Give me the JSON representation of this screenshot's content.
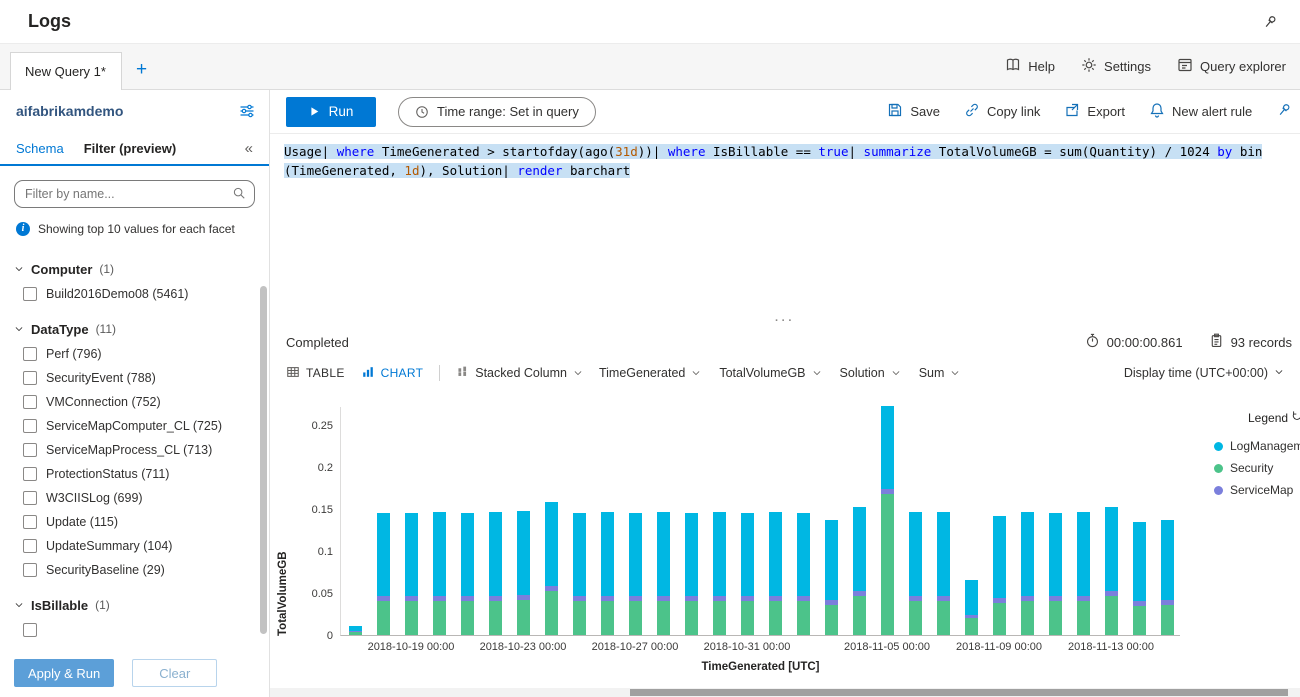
{
  "titlebar": {
    "title": "Logs"
  },
  "tabbar": {
    "active_tab": "New Query 1*",
    "new_tab": "+",
    "actions": [
      "Help",
      "Settings",
      "Query explorer"
    ]
  },
  "sidebar": {
    "workspace": "aifabrikamdemo",
    "tab_schema": "Schema",
    "tab_filter": "Filter (preview)",
    "collapse": "«",
    "search_placeholder": "Filter by name...",
    "info": "Showing top 10 values for each facet",
    "facets": [
      {
        "name": "Computer",
        "count": "(1)",
        "items": [
          {
            "label": "Build2016Demo08",
            "count": "(5461)"
          }
        ]
      },
      {
        "name": "DataType",
        "count": "(11)",
        "items": [
          {
            "label": "Perf",
            "count": "(796)"
          },
          {
            "label": "SecurityEvent",
            "count": "(788)"
          },
          {
            "label": "VMConnection",
            "count": "(752)"
          },
          {
            "label": "ServiceMapComputer_CL",
            "count": "(725)"
          },
          {
            "label": "ServiceMapProcess_CL",
            "count": "(713)"
          },
          {
            "label": "ProtectionStatus",
            "count": "(711)"
          },
          {
            "label": "W3CIISLog",
            "count": "(699)"
          },
          {
            "label": "Update",
            "count": "(115)"
          },
          {
            "label": "UpdateSummary",
            "count": "(104)"
          },
          {
            "label": "SecurityBaseline",
            "count": "(29)"
          }
        ]
      },
      {
        "name": "IsBillable",
        "count": "(1)",
        "items": [
          {
            "label": "",
            "count": ""
          }
        ]
      }
    ],
    "apply_button": "Apply & Run",
    "clear_button": "Clear"
  },
  "toolbar": {
    "run": "Run",
    "time_range": "Time range: Set in query",
    "actions": [
      "Save",
      "Copy link",
      "Export",
      "New alert rule",
      "Pin"
    ]
  },
  "query": {
    "lines": [
      [
        {
          "t": "Usage| ",
          "c": "p"
        },
        {
          "t": "where",
          "c": "k"
        },
        {
          "t": " TimeGenerated > startofday(ago(",
          "c": "p"
        },
        {
          "t": "31d",
          "c": "n"
        },
        {
          "t": "))| ",
          "c": "p"
        },
        {
          "t": "where",
          "c": "k"
        },
        {
          "t": " IsBillable == ",
          "c": "p"
        },
        {
          "t": "true",
          "c": "k"
        },
        {
          "t": "| ",
          "c": "p"
        },
        {
          "t": "summarize",
          "c": "k"
        },
        {
          "t": " TotalVolumeGB = sum(Quantity) / 1024 ",
          "c": "p"
        },
        {
          "t": "by",
          "c": "k"
        },
        {
          "t": " bin",
          "c": "p"
        }
      ],
      [
        {
          "t": "(TimeGenerated, ",
          "c": "p"
        },
        {
          "t": "1d",
          "c": "n"
        },
        {
          "t": "), Solution| ",
          "c": "p"
        },
        {
          "t": "render",
          "c": "k"
        },
        {
          "t": " barchart",
          "c": "p"
        }
      ]
    ]
  },
  "results": {
    "status": "Completed",
    "elapsed": "00:00:00.861",
    "records": "93 records",
    "table_tab": "TABLE",
    "chart_tab": "CHART",
    "chart_type": "Stacked Column",
    "dropdowns": [
      "TimeGenerated",
      "TotalVolumeGB",
      "Solution",
      "Sum"
    ],
    "display_time": "Display time (UTC+00:00)",
    "splitter": "···"
  },
  "legend": {
    "title": "Legend",
    "items": [
      {
        "label": "LogManagement",
        "color": "#00b7e3"
      },
      {
        "label": "Security",
        "color": "#4cc38a"
      },
      {
        "label": "ServiceMap",
        "color": "#7b7fdc"
      }
    ]
  },
  "chart_data": {
    "type": "bar",
    "stacked": true,
    "title": "",
    "xlabel": "TimeGenerated [UTC]",
    "ylabel": "TotalVolumeGB",
    "ylim": [
      0,
      0.2726
    ],
    "grid": false,
    "legend_position": "top-right",
    "x": [
      "2018-10-17",
      "2018-10-18",
      "2018-10-19",
      "2018-10-20",
      "2018-10-21",
      "2018-10-22",
      "2018-10-23",
      "2018-10-24",
      "2018-10-25",
      "2018-10-26",
      "2018-10-27",
      "2018-10-28",
      "2018-10-29",
      "2018-10-30",
      "2018-10-31",
      "2018-11-01",
      "2018-11-02",
      "2018-11-03",
      "2018-11-04",
      "2018-11-05",
      "2018-11-06",
      "2018-11-07",
      "2018-11-08",
      "2018-11-09",
      "2018-11-10",
      "2018-11-11",
      "2018-11-12",
      "2018-11-13",
      "2018-11-14",
      "2018-11-15"
    ],
    "xticks": [
      {
        "index": 2,
        "label": "2018-10-19 00:00"
      },
      {
        "index": 6,
        "label": "2018-10-23 00:00"
      },
      {
        "index": 10,
        "label": "2018-10-27 00:00"
      },
      {
        "index": 14,
        "label": "2018-10-31 00:00"
      },
      {
        "index": 19,
        "label": "2018-11-05 00:00"
      },
      {
        "index": 23,
        "label": "2018-11-09 00:00"
      },
      {
        "index": 27,
        "label": "2018-11-13 00:00"
      }
    ],
    "yticks": [
      {
        "v": 0,
        "label": "0"
      },
      {
        "v": 0.05,
        "label": "0.05"
      },
      {
        "v": 0.1,
        "label": "0.1"
      },
      {
        "v": 0.15,
        "label": "0.15"
      },
      {
        "v": 0.2,
        "label": "0.2"
      },
      {
        "v": 0.25,
        "label": "0.25"
      }
    ],
    "series": [
      {
        "name": "Security",
        "color": "#4cc38a",
        "values": [
          0.003,
          0.04,
          0.04,
          0.041,
          0.04,
          0.04,
          0.042,
          0.052,
          0.04,
          0.04,
          0.04,
          0.04,
          0.04,
          0.04,
          0.04,
          0.04,
          0.04,
          0.036,
          0.047,
          0.168,
          0.04,
          0.04,
          0.02,
          0.038,
          0.04,
          0.04,
          0.04,
          0.046,
          0.034,
          0.036
        ]
      },
      {
        "name": "ServiceMap",
        "color": "#7b7fdc",
        "values": [
          0.001,
          0.006,
          0.006,
          0.006,
          0.006,
          0.006,
          0.006,
          0.006,
          0.006,
          0.006,
          0.006,
          0.006,
          0.006,
          0.006,
          0.006,
          0.006,
          0.006,
          0.006,
          0.006,
          0.006,
          0.006,
          0.006,
          0.004,
          0.006,
          0.006,
          0.006,
          0.006,
          0.006,
          0.006,
          0.006
        ]
      },
      {
        "name": "LogManagement",
        "color": "#00b7e3",
        "values": [
          0.006,
          0.099,
          0.099,
          0.1,
          0.099,
          0.1,
          0.1,
          0.1,
          0.099,
          0.1,
          0.099,
          0.1,
          0.099,
          0.1,
          0.099,
          0.1,
          0.099,
          0.095,
          0.099,
          0.099,
          0.1,
          0.1,
          0.041,
          0.098,
          0.1,
          0.099,
          0.1,
          0.1,
          0.094,
          0.095
        ]
      }
    ]
  }
}
